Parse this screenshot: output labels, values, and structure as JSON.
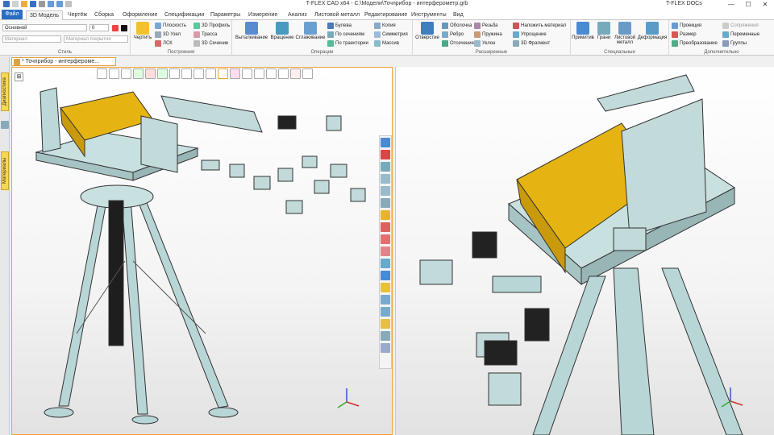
{
  "window": {
    "title": "T-FLEX CAD x64 - C:\\Модели\\Точприбор - интерферометр.grb",
    "docs_label": "T-FLEX DOCs",
    "minimize": "—",
    "maximize": "☐",
    "close": "✕"
  },
  "tabs": [
    {
      "label": "Файл"
    },
    {
      "label": "3D Модель"
    },
    {
      "label": "Чертёж"
    },
    {
      "label": "Сборка"
    },
    {
      "label": "Оформление"
    },
    {
      "label": "Спецификации"
    },
    {
      "label": "Параметры"
    },
    {
      "label": "Измерение"
    },
    {
      "label": "Анализ"
    },
    {
      "label": "Листовой металл"
    },
    {
      "label": "Редактирование"
    },
    {
      "label": "Инструменты"
    },
    {
      "label": "Вид"
    }
  ],
  "ribbon": {
    "style": {
      "layer_value": "Основной",
      "number_value": "0",
      "material_placeholder": "Материал",
      "coating_placeholder": "Материал покрытия",
      "group_label": "Стиль"
    },
    "construction": {
      "draw_label": "Чертить",
      "items": [
        "Плоскость",
        "3D Узел",
        "ЛСК",
        "3D Профиль",
        "Трасса",
        "3D Сечение"
      ],
      "group_label": "Построения"
    },
    "operations": {
      "big": [
        "Выталкивание",
        "Вращение",
        "Сглаживание"
      ],
      "items": [
        "Булева",
        "По сечениям",
        "По траектории",
        "Копия",
        "Симметрия",
        "Массив"
      ],
      "group_label": "Операции"
    },
    "extended": {
      "big": [
        "Отверстие"
      ],
      "items": [
        "Оболочка",
        "Ребро",
        "Отсечение",
        "Резьба",
        "Пружина",
        "Уклон",
        "Наложить материал",
        "Упрощение",
        "3D Фрагмент"
      ],
      "group_label": "Расширенные"
    },
    "special": {
      "big": [
        "Примитив",
        "Грани",
        "Листовой металл",
        "Деформация"
      ],
      "group_label": "Специальные"
    },
    "additional": {
      "items": [
        "Проекция",
        "Размер",
        "Преобразование",
        "Сопряжения",
        "Переменные",
        "Группы"
      ],
      "group_label": "Дополнительно"
    }
  },
  "left_panel": {
    "diagnostics": "Диагностика",
    "materials": "Материалы"
  },
  "document_tab": "* Точприбор - интерферомe...",
  "colors": {
    "accent": "#2b6cc4",
    "viewport_border": "#f0a030",
    "model_body": "#b9d6d6",
    "model_yellow": "#e8b410"
  }
}
